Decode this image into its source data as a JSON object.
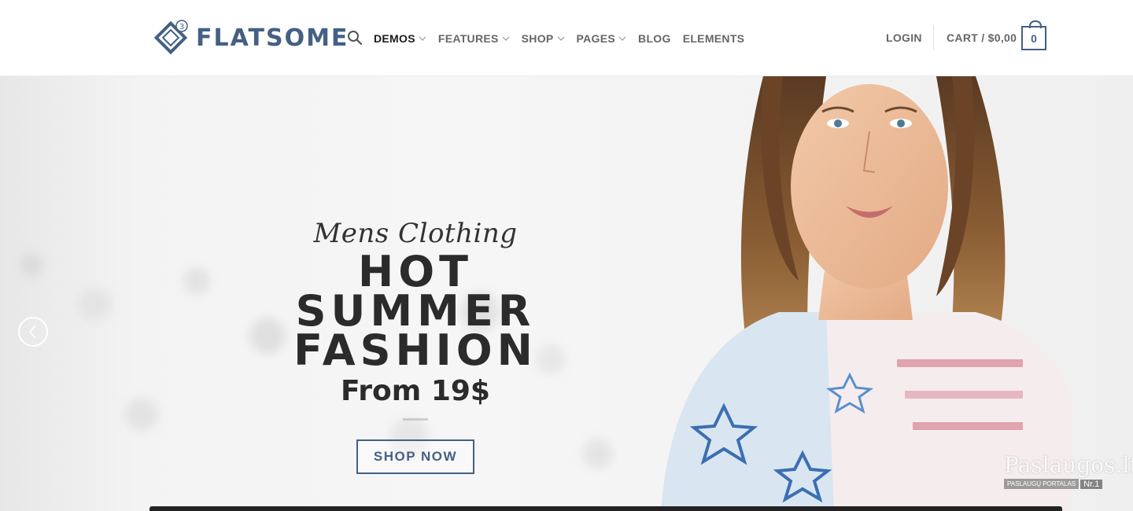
{
  "header": {
    "logo_text": "FLATSOME",
    "logo_badge": "3",
    "nav": [
      {
        "label": "DEMOS",
        "dropdown": true
      },
      {
        "label": "FEATURES",
        "dropdown": true
      },
      {
        "label": "SHOP",
        "dropdown": true
      },
      {
        "label": "PAGES",
        "dropdown": true
      },
      {
        "label": "BLOG",
        "dropdown": false
      },
      {
        "label": "ELEMENTS",
        "dropdown": false
      }
    ],
    "login_label": "LOGIN",
    "cart_label": "CART / $0,00",
    "cart_count": "0"
  },
  "hero": {
    "script_text": "Mens Clothing",
    "title_line1": "HOT SUMMER",
    "title_line2": "FASHION",
    "price_text": "From 19$",
    "button_label": "SHOP NOW"
  },
  "watermark": {
    "text": "Paslaugos.lt",
    "sub1": "PASLAUGŲ PORTALAS",
    "sub2": "Nr.1"
  },
  "colors": {
    "brand": "#446084",
    "text": "#333333",
    "nav": "#666666"
  }
}
